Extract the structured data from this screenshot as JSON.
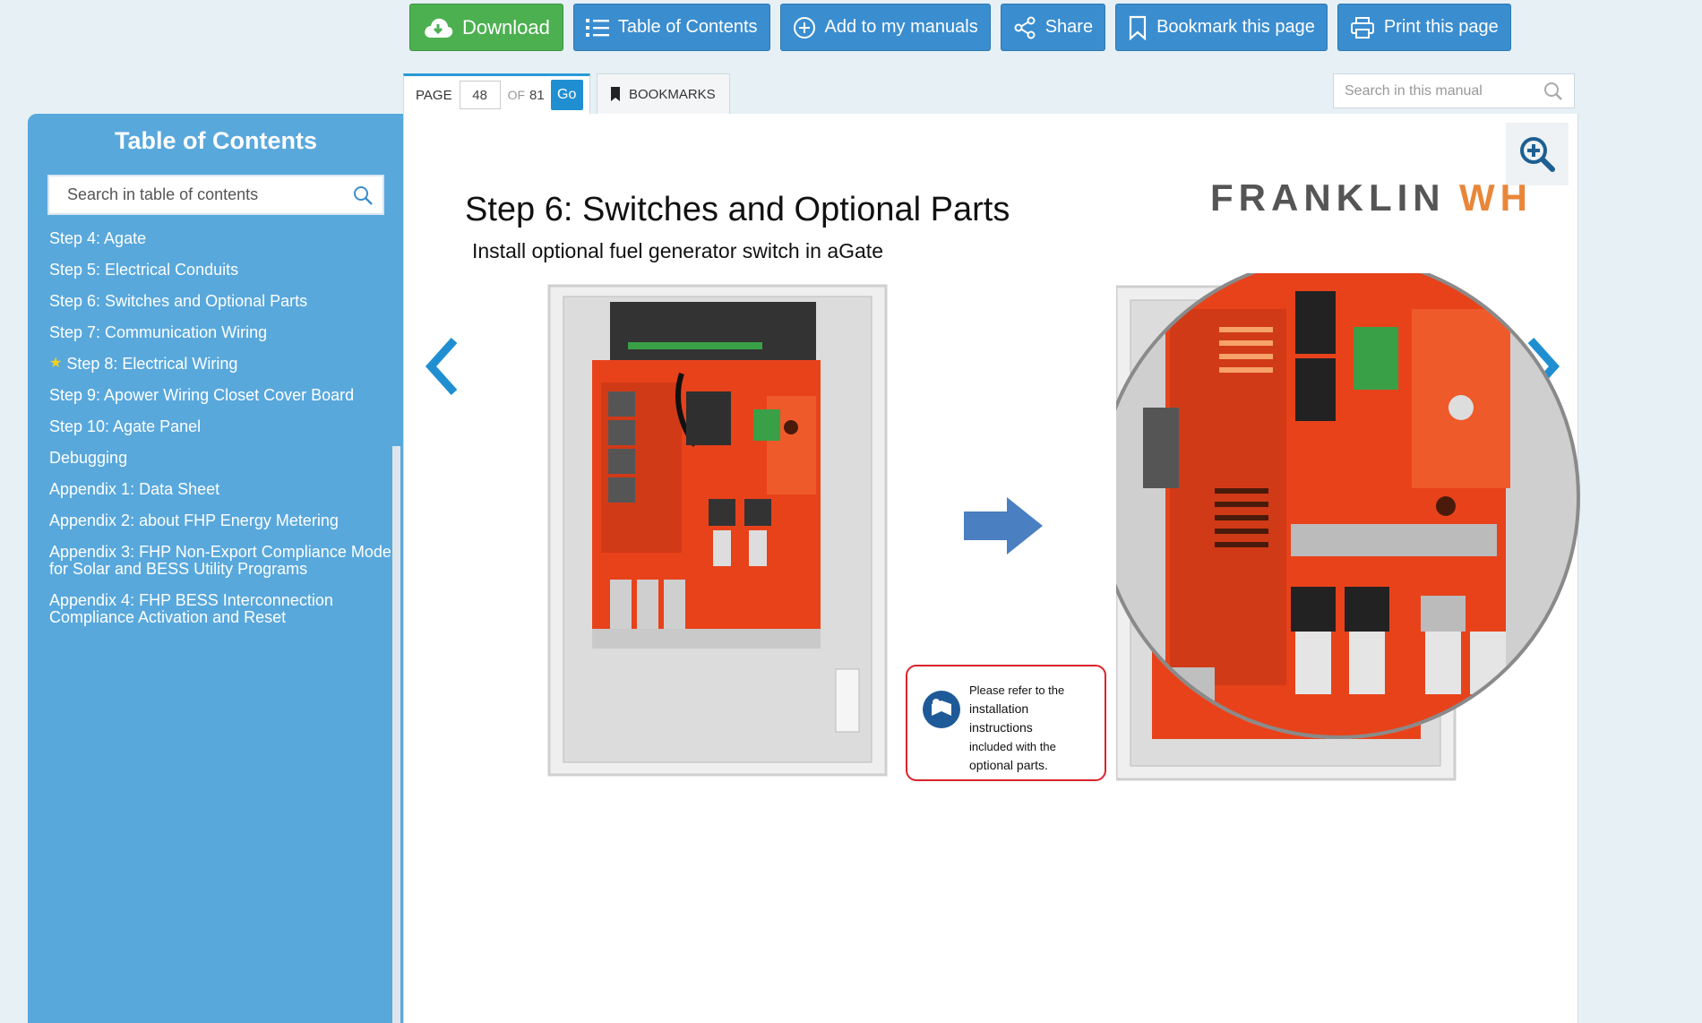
{
  "toolbar": {
    "download": "Download",
    "toc": "Table of Contents",
    "add": "Add to my manuals",
    "share": "Share",
    "bookmark": "Bookmark this page",
    "print": "Print this page"
  },
  "pager": {
    "page_label": "PAGE",
    "current": "48",
    "of_label": "OF",
    "total": "81",
    "go": "Go"
  },
  "bookmarks_tab": "BOOKMARKS",
  "search_manual": {
    "placeholder": "Search in this manual"
  },
  "sidebar": {
    "title": "Table of Contents",
    "search_placeholder": "Search in table of contents",
    "items": [
      {
        "label": "Step 4: Agate"
      },
      {
        "label": "Step 5: Electrical Conduits"
      },
      {
        "label": "Step 6: Switches and Optional Parts"
      },
      {
        "label": "Step 7: Communication Wiring"
      },
      {
        "label": "Step 8: Electrical Wiring"
      },
      {
        "label": "Step 9: Apower Wiring Closet Cover Board"
      },
      {
        "label": "Step 10: Agate Panel"
      },
      {
        "label": "Debugging"
      },
      {
        "label": "Appendix 1: Data Sheet"
      },
      {
        "label": "Appendix 2: about FHP Energy Metering"
      },
      {
        "label": "Appendix 3: FHP Non-Export Compliance Mode for Solar and BESS Utility Programs"
      },
      {
        "label": "Appendix 4: FHP BESS Interconnection Compliance Activation and Reset"
      }
    ]
  },
  "document": {
    "title": "Step 6: Switches and Optional Parts",
    "subtitle": "Install optional fuel generator switch in aGate",
    "brand_part1": "FRANKLIN",
    "brand_part2": "WH",
    "note_line1": "Please refer to the",
    "note_line2": "installation",
    "note_line3": "instructions",
    "note_line4": "included with the",
    "note_line5": "optional parts."
  },
  "colors": {
    "accent": "#3a8dcf",
    "download": "#4cb050",
    "sidebar": "#58a8dc",
    "panel_orange": "#e8421b",
    "brand_orange": "#e8873a"
  }
}
